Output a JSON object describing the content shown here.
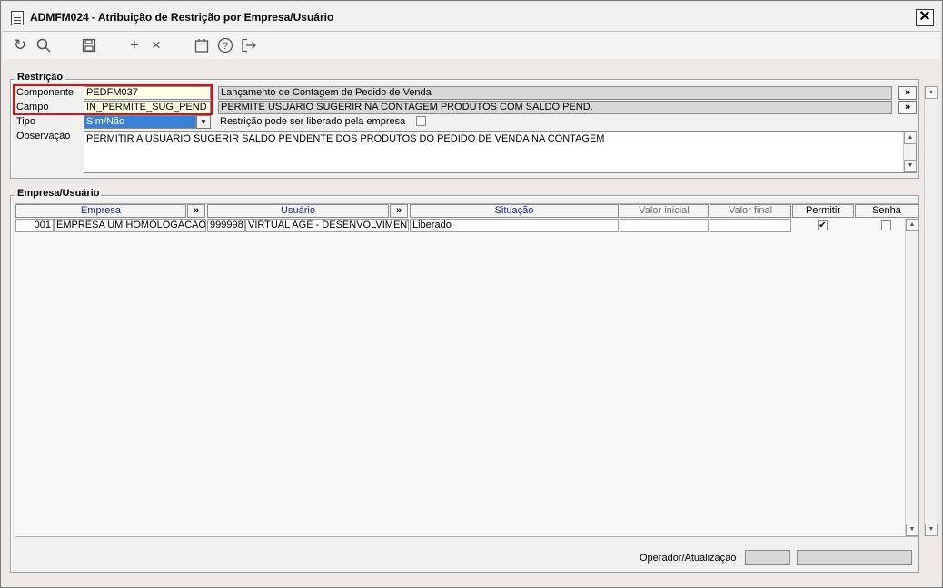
{
  "window": {
    "title": "ADMFM024 - Atribuição de Restrição por Empresa/Usuário",
    "close_label": "✕"
  },
  "toolbar": {
    "icons": [
      "refresh-icon",
      "search-icon",
      "save-icon",
      "add-icon",
      "delete-icon",
      "calendar-icon",
      "help-icon",
      "exit-icon"
    ]
  },
  "restricao": {
    "section_title": "Restrição",
    "componente_label": "Componente",
    "componente_value": "PEDFM037",
    "componente_desc": "Lançamento de Contagem de Pedido de Venda",
    "campo_label": "Campo",
    "campo_value": "IN_PERMITE_SUG_PEND",
    "campo_desc": "PERMITE USUARIO SUGERIR NA CONTAGEM PRODUTOS COM SALDO PEND.",
    "tipo_label": "Tipo",
    "tipo_value": "Sim/Não",
    "liberado_label": "Restrição pode ser liberado pela empresa",
    "observacao_label": "Observação",
    "observacao_value": "PERMITIR A USUARIO SUGERIR SALDO PENDENTE DOS PRODUTOS DO PEDIDO DE VENDA NA CONTAGEM",
    "more_label": "»"
  },
  "empresa_usuario": {
    "section_title": "Empresa/Usuário",
    "columns": {
      "empresa": "Empresa",
      "usuario": "Usuário",
      "situacao": "Situação",
      "valor_inicial": "Valor inicial",
      "valor_final": "Valor final",
      "permitir": "Permitir",
      "senha": "Senha"
    },
    "more_label": "»",
    "rows": [
      {
        "empresa_code": "001",
        "empresa_name": "EMPRESA UM HOMOLOGACAO",
        "usuario_code": "999998",
        "usuario_name": "VIRTUAL AGE - DESENVOLVIMENTO",
        "situacao": "Liberado",
        "valor_inicial": "",
        "valor_final": "",
        "permitir": "✔",
        "senha": ""
      }
    ]
  },
  "footer": {
    "operador_label": "Operador/Atualização",
    "operador_value": "",
    "atualizacao_value": ""
  },
  "colors": {
    "highlight": "#e01010",
    "select_bg": "#3a80d6",
    "header_link": "#1a2a9a"
  }
}
